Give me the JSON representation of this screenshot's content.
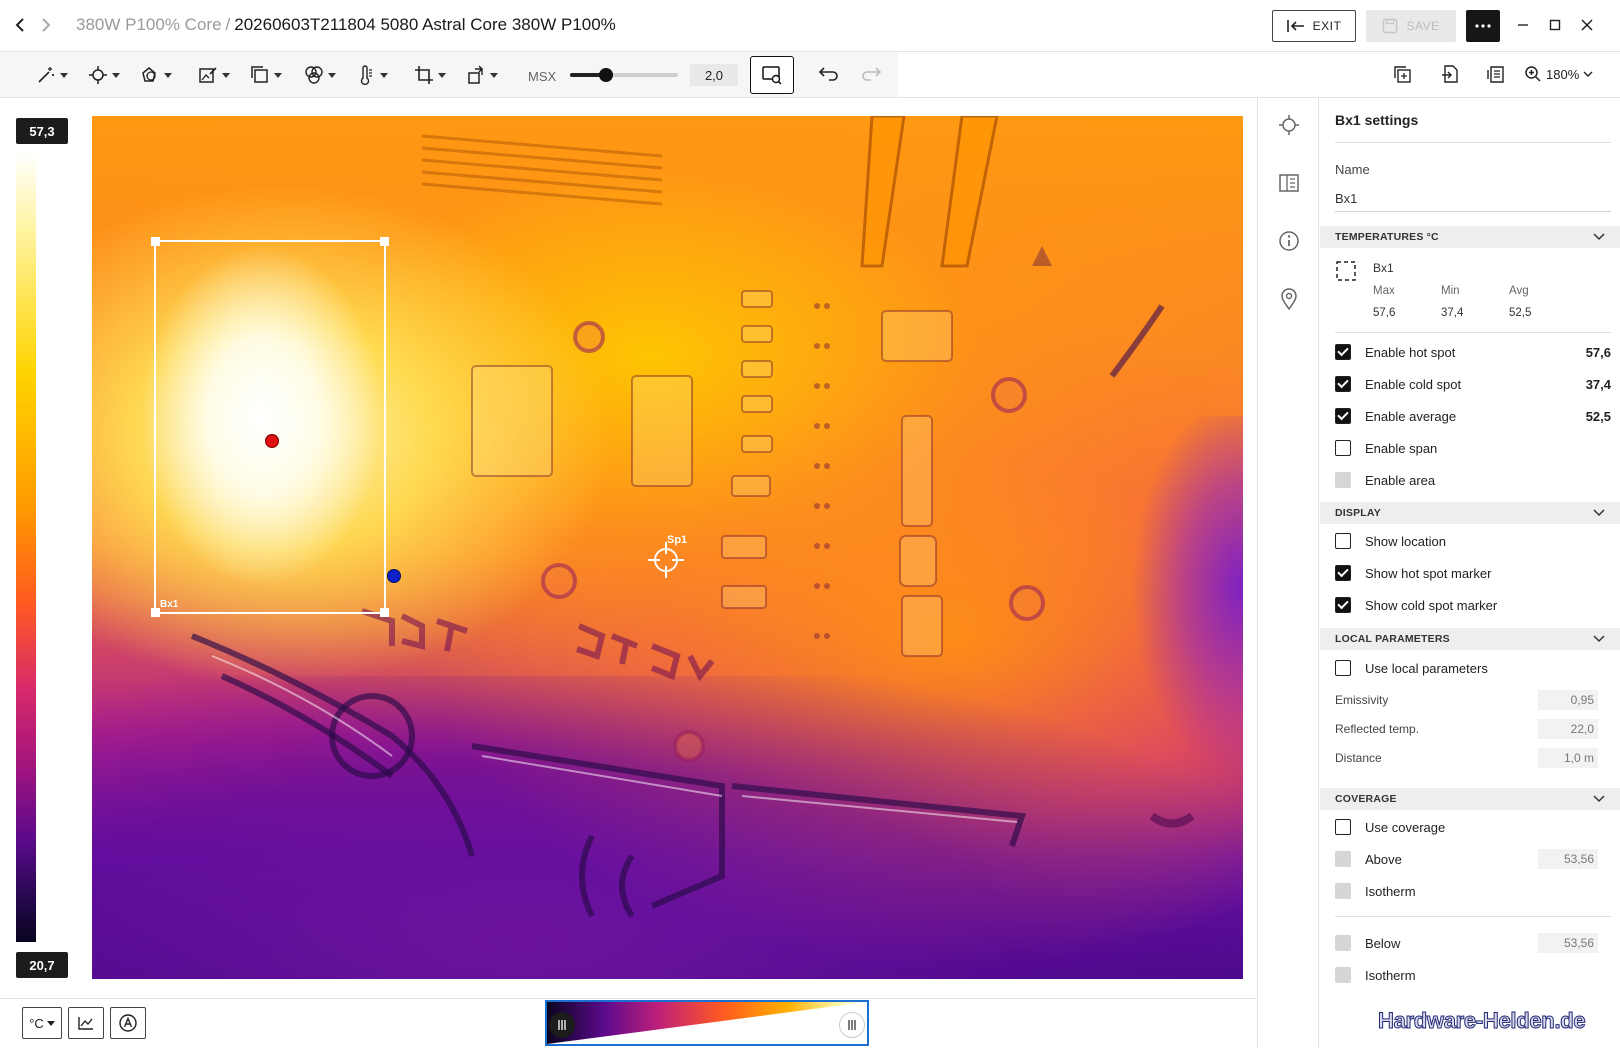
{
  "titlebar": {
    "folder": "380W P100% Core",
    "separator": "/",
    "file": "20260603T211804 5080 Astral Core 380W P100%",
    "exit_label": "EXIT",
    "save_label": "SAVE"
  },
  "toolbar": {
    "msx_label": "MSX",
    "msx_value": "2,0",
    "msx_slider_fraction": 0.33,
    "zoom_label": "180%"
  },
  "scale": {
    "max": "57,3",
    "min": "20,7"
  },
  "image": {
    "box_label": "Bx1",
    "spot_label": "Sp1"
  },
  "bottombar": {
    "unit_label": "°C"
  },
  "panel": {
    "title": "Bx1 settings",
    "name_label": "Name",
    "name_value": "Bx1",
    "temperatures": {
      "header": "TEMPERATURES °C",
      "item": "Bx1",
      "max_label": "Max",
      "min_label": "Min",
      "avg_label": "Avg",
      "max": "57,6",
      "min": "37,4",
      "avg": "52,5",
      "enable_hot_spot": "Enable hot spot",
      "enable_hot_spot_value": "57,6",
      "enable_cold_spot": "Enable cold spot",
      "enable_cold_spot_value": "37,4",
      "enable_average": "Enable average",
      "enable_average_value": "52,5",
      "enable_span": "Enable span",
      "enable_area": "Enable area"
    },
    "display": {
      "header": "DISPLAY",
      "show_location": "Show location",
      "show_hot_spot_marker": "Show hot spot marker",
      "show_cold_spot_marker": "Show cold spot marker"
    },
    "local_parameters": {
      "header": "LOCAL PARAMETERS",
      "use_local": "Use local parameters",
      "emissivity_label": "Emissivity",
      "emissivity": "0,95",
      "reflected_label": "Reflected temp.",
      "reflected": "22,0",
      "distance_label": "Distance",
      "distance": "1,0 m"
    },
    "coverage": {
      "header": "COVERAGE",
      "use_coverage": "Use coverage",
      "above": "Above",
      "above_value": "53,56",
      "isotherm": "Isotherm",
      "below": "Below",
      "below_value": "53,56",
      "isotherm2": "Isotherm"
    }
  },
  "watermark": "Hardware-Helden.de",
  "colors": {
    "accent": "#1a6fd0",
    "dark": "#161616",
    "hot_marker": "#e01010",
    "cold_marker": "#1020c8"
  }
}
